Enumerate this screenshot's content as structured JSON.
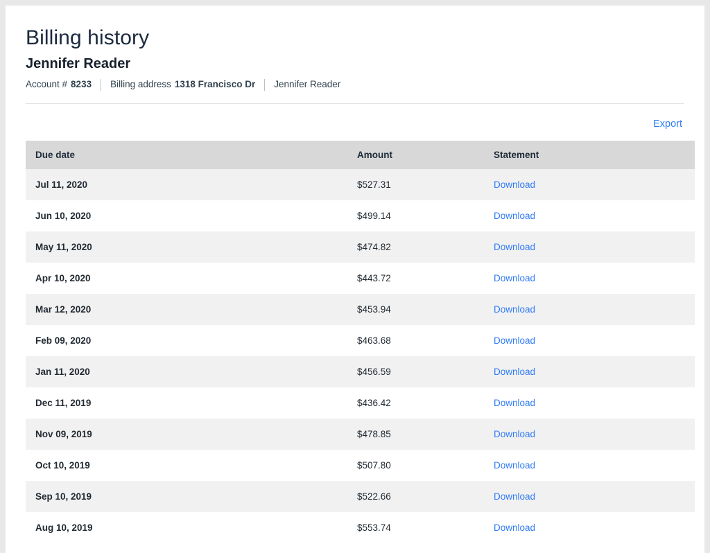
{
  "header": {
    "title": "Billing history",
    "account_name": "Jennifer Reader",
    "meta": {
      "account_label": "Account #",
      "account_value": "8233",
      "address_label": "Billing address",
      "address_value": "1318 Francisco Dr",
      "contact_name": "Jennifer Reader"
    }
  },
  "toolbar": {
    "export_label": "Export"
  },
  "table": {
    "columns": [
      "Due date",
      "Amount",
      "Statement"
    ],
    "rows": [
      {
        "due_date": "Jul 11, 2020",
        "amount": "$527.31",
        "statement": "Download"
      },
      {
        "due_date": "Jun 10, 2020",
        "amount": "$499.14",
        "statement": "Download"
      },
      {
        "due_date": "May 11, 2020",
        "amount": "$474.82",
        "statement": "Download"
      },
      {
        "due_date": "Apr 10, 2020",
        "amount": "$443.72",
        "statement": "Download"
      },
      {
        "due_date": "Mar 12, 2020",
        "amount": "$453.94",
        "statement": "Download"
      },
      {
        "due_date": "Feb 09, 2020",
        "amount": "$463.68",
        "statement": "Download"
      },
      {
        "due_date": "Jan 11, 2020",
        "amount": "$456.59",
        "statement": "Download"
      },
      {
        "due_date": "Dec 11, 2019",
        "amount": "$436.42",
        "statement": "Download"
      },
      {
        "due_date": "Nov 09, 2019",
        "amount": "$478.85",
        "statement": "Download"
      },
      {
        "due_date": "Oct 10, 2019",
        "amount": "$507.80",
        "statement": "Download"
      },
      {
        "due_date": "Sep 10, 2019",
        "amount": "$522.66",
        "statement": "Download"
      },
      {
        "due_date": "Aug 10, 2019",
        "amount": "$553.74",
        "statement": "Download"
      }
    ]
  },
  "colors": {
    "page_background": "#e8e8e8",
    "card_background": "#ffffff",
    "table_header_background": "#d8d8d8",
    "row_stripe": "#f1f1f1",
    "link_blue": "#2f7bf6",
    "text_dark": "#1b2a3d"
  }
}
